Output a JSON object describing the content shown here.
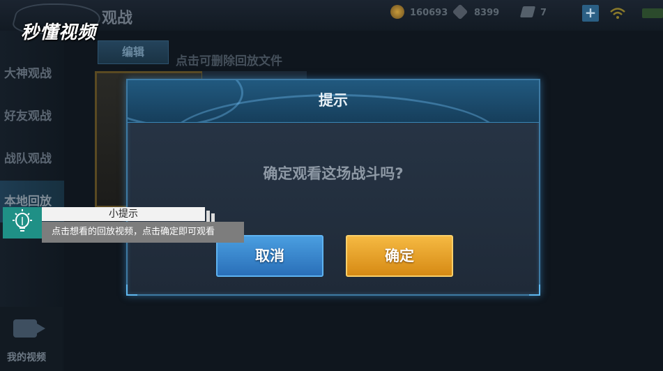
{
  "header": {
    "logo_text": "秒懂视频",
    "page_title": "观战",
    "resources": [
      {
        "icon": "gold-coin-icon",
        "value": "160693"
      },
      {
        "icon": "diamond-icon",
        "value": "8399"
      },
      {
        "icon": "ticket-icon",
        "value": "7"
      }
    ]
  },
  "sidebar": {
    "items": [
      {
        "label": "大神观战"
      },
      {
        "label": "好友观战"
      },
      {
        "label": "战队观战"
      },
      {
        "label": "本地回放"
      }
    ],
    "video_label": "我的视频"
  },
  "toolbar": {
    "edit_label": "编辑",
    "hint": "点击可删除回放文件"
  },
  "dialog": {
    "title": "提示",
    "message": "确定观看这场战斗吗?",
    "cancel_label": "取消",
    "confirm_label": "确定"
  },
  "tip": {
    "title": "小提示",
    "body": "点击想看的回放视频，点击确定即可观看"
  },
  "colors": {
    "cancel": "#2a6fb8",
    "confirm": "#e69e24",
    "tip_accent": "#1f9086"
  }
}
